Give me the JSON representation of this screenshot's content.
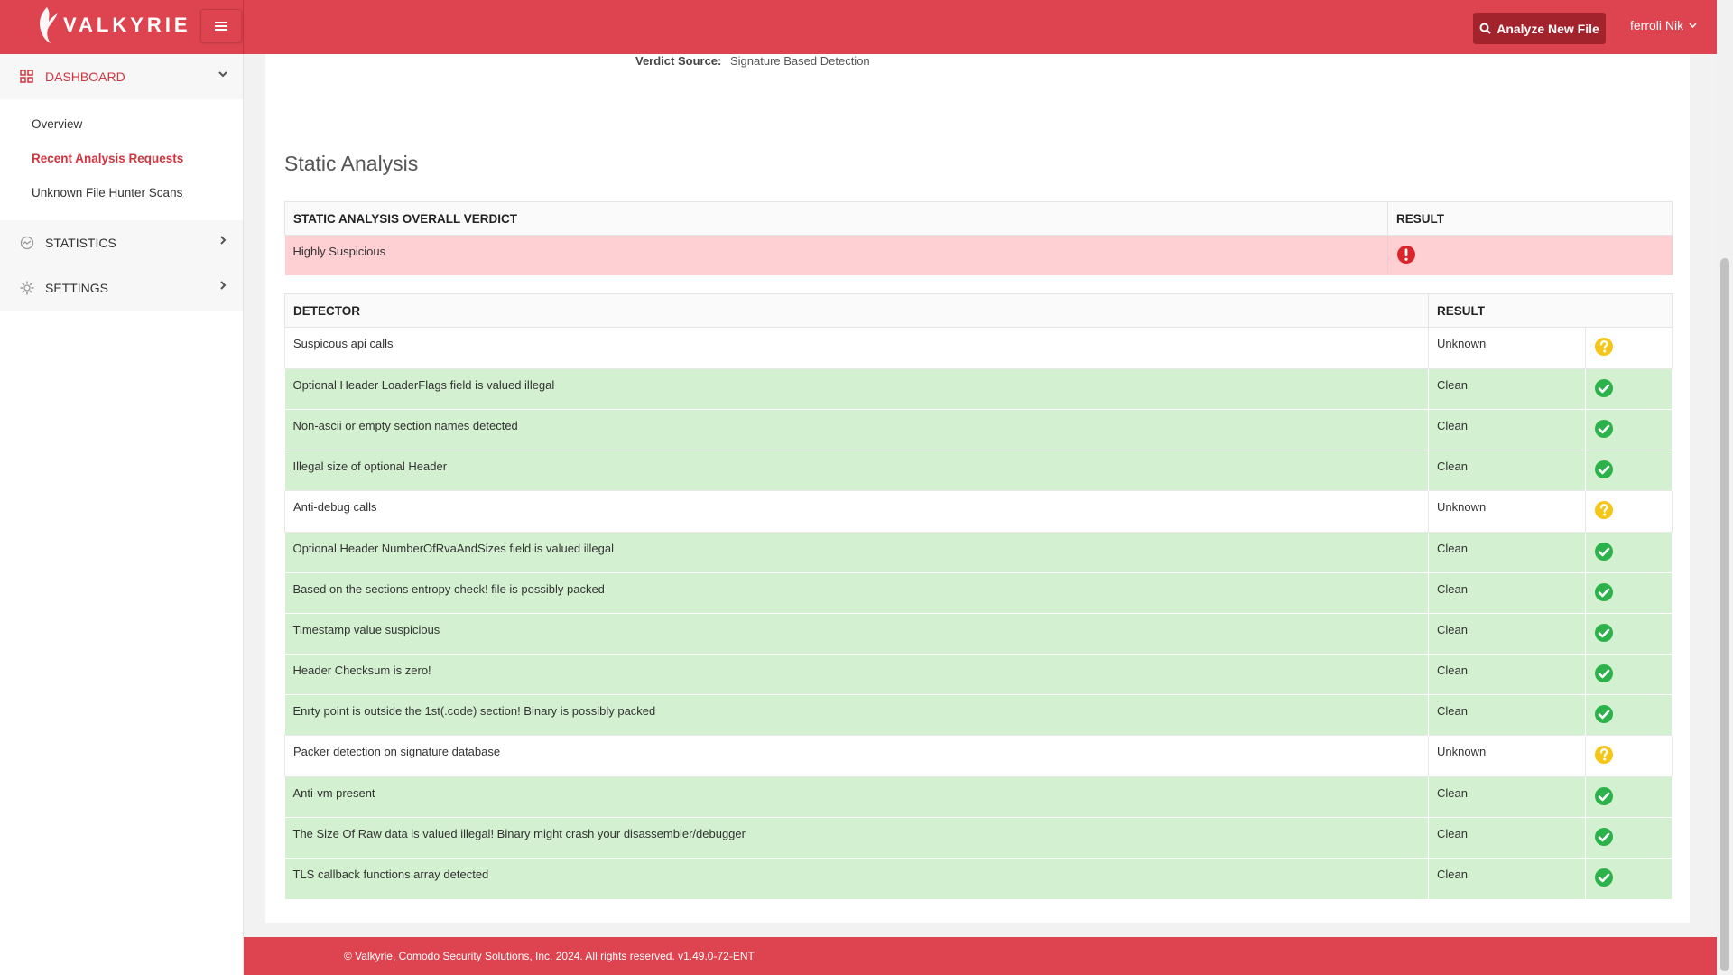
{
  "brand": {
    "name": "VALKYRIE"
  },
  "header": {
    "analyze_button": "Analyze New File",
    "user_name": "ferroli Nik"
  },
  "sidebar": {
    "dashboard": {
      "label": "DASHBOARD",
      "items": [
        "Overview",
        "Recent Analysis Requests",
        "Unknown File Hunter Scans"
      ]
    },
    "statistics": {
      "label": "STATISTICS"
    },
    "settings": {
      "label": "SETTINGS"
    }
  },
  "verdict_source": {
    "label": "Verdict Source:",
    "value": "Signature Based Detection"
  },
  "static_analysis": {
    "title": "Static Analysis",
    "overall": {
      "headers": [
        "STATIC ANALYSIS OVERALL VERDICT",
        "RESULT"
      ],
      "verdict": "Highly Suspicious",
      "icon": "error-icon"
    },
    "detectors": {
      "headers": [
        "DETECTOR",
        "RESULT"
      ],
      "rows": [
        {
          "detector": "Suspicous api calls",
          "result": "Unknown",
          "icon": "question-icon"
        },
        {
          "detector": "Optional Header LoaderFlags field is valued illegal",
          "result": "Clean",
          "icon": "check-icon"
        },
        {
          "detector": "Non-ascii or empty section names detected",
          "result": "Clean",
          "icon": "check-icon"
        },
        {
          "detector": "Illegal size of optional Header",
          "result": "Clean",
          "icon": "check-icon"
        },
        {
          "detector": "Anti-debug calls",
          "result": "Unknown",
          "icon": "question-icon"
        },
        {
          "detector": "Optional Header NumberOfRvaAndSizes field is valued illegal",
          "result": "Clean",
          "icon": "check-icon"
        },
        {
          "detector": "Based on the sections entropy check! file is possibly packed",
          "result": "Clean",
          "icon": "check-icon"
        },
        {
          "detector": "Timestamp value suspicious",
          "result": "Clean",
          "icon": "check-icon"
        },
        {
          "detector": "Header Checksum is zero!",
          "result": "Clean",
          "icon": "check-icon"
        },
        {
          "detector": "Enrty point is outside the 1st(.code) section! Binary is possibly packed",
          "result": "Clean",
          "icon": "check-icon"
        },
        {
          "detector": "Packer detection on signature database",
          "result": "Unknown",
          "icon": "question-icon"
        },
        {
          "detector": "Anti-vm present",
          "result": "Clean",
          "icon": "check-icon"
        },
        {
          "detector": "The Size Of Raw data is valued illegal! Binary might crash your disassembler/debugger",
          "result": "Clean",
          "icon": "check-icon"
        },
        {
          "detector": "TLS callback functions array detected",
          "result": "Clean",
          "icon": "check-icon"
        }
      ]
    }
  },
  "footer": {
    "text": "© Valkyrie, Comodo Security Solutions, Inc. 2024. All rights reserved. v1.49.0-72-ENT"
  },
  "colors": {
    "brand_red": "#dd444f",
    "clean_green": "#d3f1d0",
    "suspicious_pink": "#fecfd3",
    "check": "#2cb24a",
    "question": "#f5c518",
    "error": "#d9262c"
  }
}
